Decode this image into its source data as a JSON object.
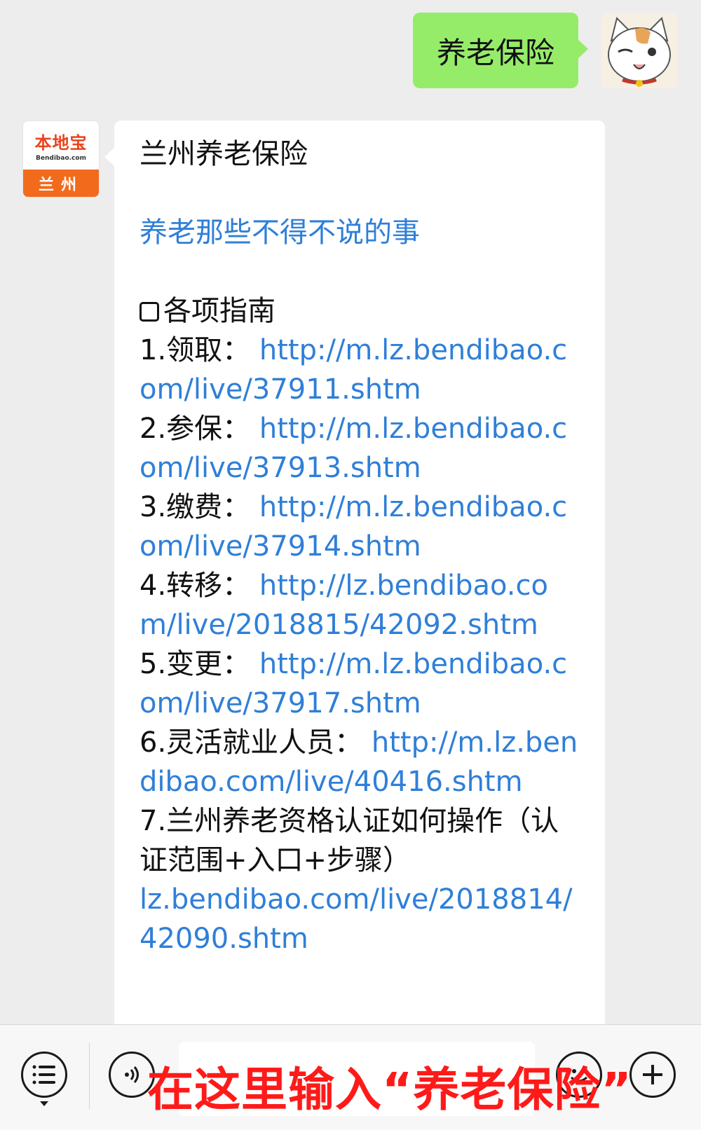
{
  "outgoing_message": {
    "text": "养老保险"
  },
  "incoming_avatar": {
    "logo_text": "本地宝",
    "logo_sub": "Bendibao.com",
    "city": "兰州"
  },
  "incoming_message": {
    "title": "兰州养老保险",
    "subtitle_link": "养老那些不得不说的事",
    "section_heading": "各项指南",
    "items": [
      {
        "label": "1.领取：",
        "link": "http://m.lz.bendibao.com/live/37911.shtm"
      },
      {
        "label": "2.参保：",
        "link": "http://m.lz.bendibao.com/live/37913.shtm"
      },
      {
        "label": "3.缴费：",
        "link": "http://m.lz.bendibao.com/live/37914.shtm"
      },
      {
        "label": "4.转移：",
        "link": "http://lz.bendibao.com/live/2018815/42092.shtm"
      },
      {
        "label": "5.变更：",
        "link": "http://m.lz.bendibao.com/live/37917.shtm"
      },
      {
        "label": "6.灵活就业人员：",
        "link": "http://m.lz.bendibao.com/live/40416.shtm"
      },
      {
        "label": "7.兰州养老资格认证如何操作（认证范围+入口+步骤）",
        "link": "lz.bendibao.com/live/2018814/42090.shtm"
      }
    ]
  },
  "input_bar": {
    "overlay_text": "在这里输入“养老保险”"
  },
  "colors": {
    "link": "#2f7fd8",
    "outgoing_bubble": "#95ec69",
    "overlay": "#ff1a1a"
  }
}
